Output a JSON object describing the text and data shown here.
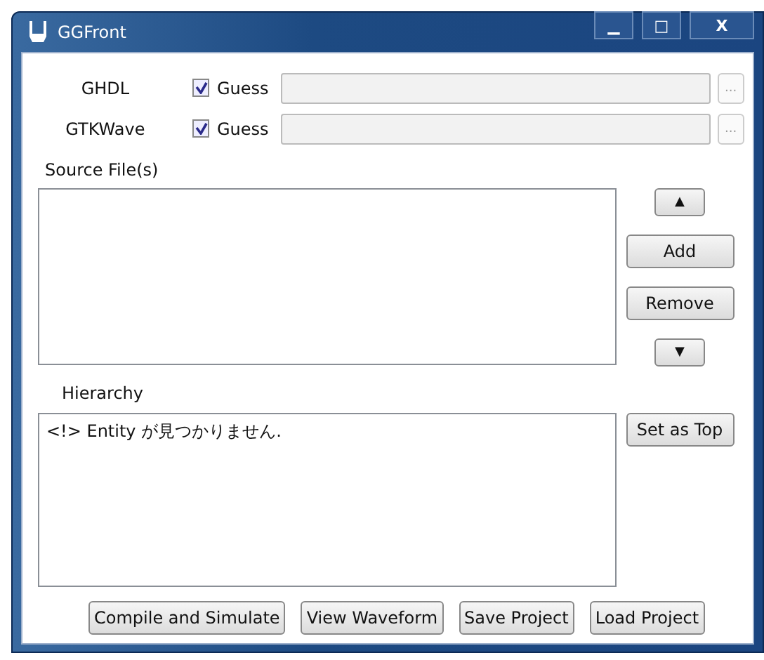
{
  "window": {
    "title": "GGFront",
    "controls": [
      "▁",
      "□",
      "X"
    ]
  },
  "tools": [
    {
      "name": "GHDL",
      "guess_label": "Guess",
      "guess": true,
      "browse": "..."
    },
    {
      "name": "GTKWave",
      "guess_label": "Guess",
      "guess": true,
      "browse": "..."
    }
  ],
  "sources": {
    "label": "Source File(s)",
    "buttons": [
      {
        "label": "▲"
      },
      {
        "label": "Add"
      },
      {
        "label": "Remove"
      },
      {
        "label": "▼"
      }
    ]
  },
  "hierarchy": {
    "label": "Hierarchy",
    "lines": [
      "<!> Entity が見つかりません."
    ],
    "button": "Set as Top"
  },
  "actions": [
    "Compile and Simulate",
    "View Waveform",
    "Save Project",
    "Load Project"
  ]
}
